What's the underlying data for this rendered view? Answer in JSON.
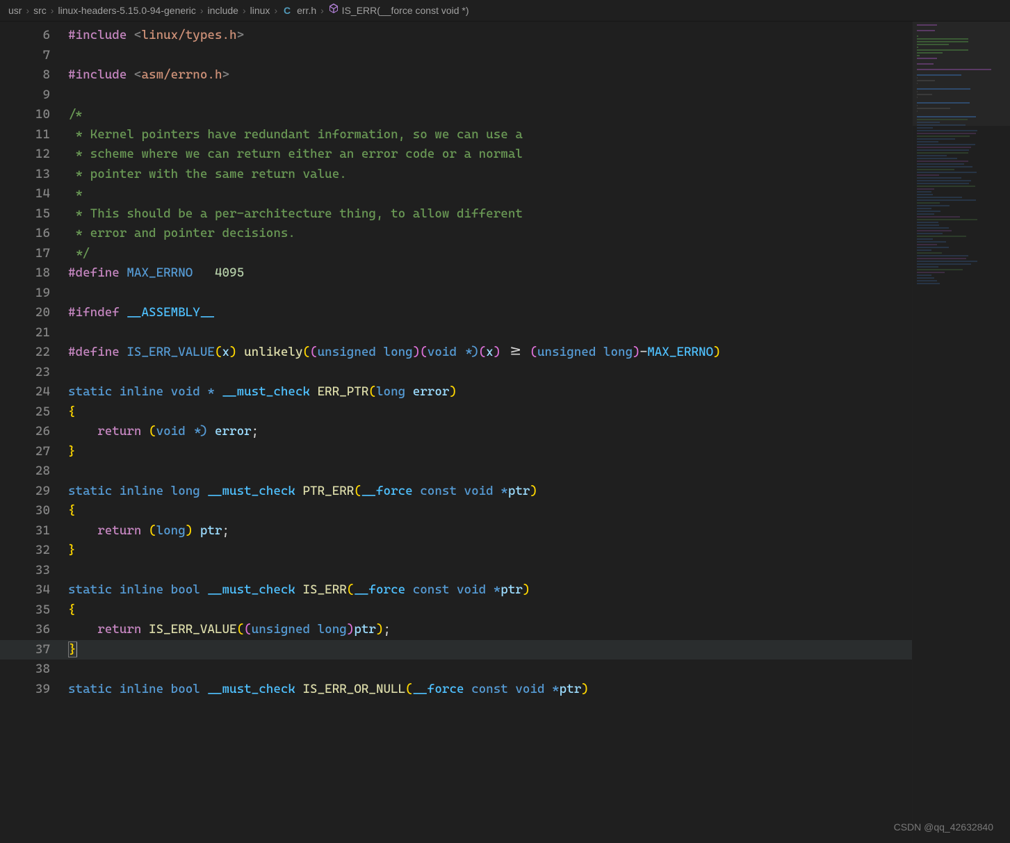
{
  "breadcrumbs": {
    "items": [
      {
        "label": "usr",
        "kind": "folder"
      },
      {
        "label": "src",
        "kind": "folder"
      },
      {
        "label": "linux-headers-5.15.0-94-generic",
        "kind": "folder"
      },
      {
        "label": "include",
        "kind": "folder"
      },
      {
        "label": "linux",
        "kind": "folder"
      },
      {
        "label": "err.h",
        "kind": "file",
        "lang": "C"
      },
      {
        "label": "IS_ERR(__force const void *)",
        "kind": "function"
      }
    ],
    "separator": "›"
  },
  "editor": {
    "first_line_number": 6,
    "current_line_number": 37,
    "lines": [
      {
        "n": 6,
        "tokens": [
          {
            "t": "#include ",
            "c": "tok-macro"
          },
          {
            "t": "<",
            "c": "tok-angle"
          },
          {
            "t": "linux/types.h",
            "c": "tok-inc-path"
          },
          {
            "t": ">",
            "c": "tok-angle"
          }
        ]
      },
      {
        "n": 7,
        "tokens": []
      },
      {
        "n": 8,
        "tokens": [
          {
            "t": "#include ",
            "c": "tok-macro"
          },
          {
            "t": "<",
            "c": "tok-angle"
          },
          {
            "t": "asm/errno.h",
            "c": "tok-inc-path"
          },
          {
            "t": ">",
            "c": "tok-angle"
          }
        ]
      },
      {
        "n": 9,
        "tokens": []
      },
      {
        "n": 10,
        "tokens": [
          {
            "t": "/*",
            "c": "tok-comment"
          }
        ]
      },
      {
        "n": 11,
        "tokens": [
          {
            "t": " * Kernel pointers have redundant information, so we can use a",
            "c": "tok-comment"
          }
        ]
      },
      {
        "n": 12,
        "tokens": [
          {
            "t": " * scheme where we can return either an error code or a normal",
            "c": "tok-comment"
          }
        ]
      },
      {
        "n": 13,
        "tokens": [
          {
            "t": " * pointer with the same return value.",
            "c": "tok-comment"
          }
        ]
      },
      {
        "n": 14,
        "tokens": [
          {
            "t": " *",
            "c": "tok-comment"
          }
        ]
      },
      {
        "n": 15,
        "tokens": [
          {
            "t": " * This should be a per-architecture thing, to allow different",
            "c": "tok-comment"
          }
        ]
      },
      {
        "n": 16,
        "tokens": [
          {
            "t": " * error and pointer decisions.",
            "c": "tok-comment"
          }
        ]
      },
      {
        "n": 17,
        "tokens": [
          {
            "t": " */",
            "c": "tok-comment"
          }
        ]
      },
      {
        "n": 18,
        "tokens": [
          {
            "t": "#define ",
            "c": "tok-macro"
          },
          {
            "t": "MAX_ERRNO",
            "c": "tok-define-name"
          },
          {
            "t": "   ",
            "c": ""
          },
          {
            "t": "4095",
            "c": "tok-number"
          }
        ]
      },
      {
        "n": 19,
        "tokens": []
      },
      {
        "n": 20,
        "tokens": [
          {
            "t": "#ifndef ",
            "c": "tok-macro"
          },
          {
            "t": "__ASSEMBLY__",
            "c": "tok-const"
          }
        ]
      },
      {
        "n": 21,
        "tokens": []
      },
      {
        "n": 22,
        "tokens": [
          {
            "t": "#define ",
            "c": "tok-macro"
          },
          {
            "t": "IS_ERR_VALUE",
            "c": "tok-define-name"
          },
          {
            "t": "(",
            "c": "p1"
          },
          {
            "t": "x",
            "c": "tok-ident"
          },
          {
            "t": ")",
            "c": "p1"
          },
          {
            "t": " ",
            "c": ""
          },
          {
            "t": "unlikely",
            "c": "tok-func"
          },
          {
            "t": "(",
            "c": "p1"
          },
          {
            "t": "(",
            "c": "p2"
          },
          {
            "t": "unsigned long",
            "c": "tok-kw"
          },
          {
            "t": ")",
            "c": "p2"
          },
          {
            "t": "(",
            "c": "p2"
          },
          {
            "t": "void ",
            "c": "tok-kw"
          },
          {
            "t": "*",
            "c": "tok-kw"
          },
          {
            "t": ")",
            "c": "p2"
          },
          {
            "t": "(",
            "c": "p2"
          },
          {
            "t": "x",
            "c": "tok-ident"
          },
          {
            "t": ")",
            "c": "p2"
          },
          {
            "t": " >= ",
            "c": "tok-op"
          },
          {
            "t": "(",
            "c": "p2"
          },
          {
            "t": "unsigned long",
            "c": "tok-kw"
          },
          {
            "t": ")",
            "c": "p2"
          },
          {
            "t": "-",
            "c": "tok-op"
          },
          {
            "t": "MAX_ERRNO",
            "c": "tok-const"
          },
          {
            "t": ")",
            "c": "p1"
          }
        ]
      },
      {
        "n": 23,
        "tokens": []
      },
      {
        "n": 24,
        "tokens": [
          {
            "t": "static inline void ",
            "c": "tok-kw"
          },
          {
            "t": "*",
            "c": "tok-kw"
          },
          {
            "t": " ",
            "c": ""
          },
          {
            "t": "__must_check",
            "c": "tok-const"
          },
          {
            "t": " ",
            "c": ""
          },
          {
            "t": "ERR_PTR",
            "c": "tok-func"
          },
          {
            "t": "(",
            "c": "p1"
          },
          {
            "t": "long ",
            "c": "tok-kw"
          },
          {
            "t": "error",
            "c": "tok-ident"
          },
          {
            "t": ")",
            "c": "p1"
          }
        ]
      },
      {
        "n": 25,
        "tokens": [
          {
            "t": "{",
            "c": "by1"
          }
        ]
      },
      {
        "n": 26,
        "indent": 1,
        "tokens": [
          {
            "t": "return ",
            "c": "tok-ret"
          },
          {
            "t": "(",
            "c": "p1"
          },
          {
            "t": "void ",
            "c": "tok-kw"
          },
          {
            "t": "*",
            "c": "tok-kw"
          },
          {
            "t": ")",
            "c": "p1"
          },
          {
            "t": " ",
            "c": ""
          },
          {
            "t": "error",
            "c": "tok-ident"
          },
          {
            "t": ";",
            "c": "tok-op"
          }
        ]
      },
      {
        "n": 27,
        "tokens": [
          {
            "t": "}",
            "c": "by1"
          }
        ]
      },
      {
        "n": 28,
        "tokens": []
      },
      {
        "n": 29,
        "tokens": [
          {
            "t": "static inline long ",
            "c": "tok-kw"
          },
          {
            "t": "__must_check",
            "c": "tok-const"
          },
          {
            "t": " ",
            "c": ""
          },
          {
            "t": "PTR_ERR",
            "c": "tok-func"
          },
          {
            "t": "(",
            "c": "p1"
          },
          {
            "t": "__force",
            "c": "tok-const"
          },
          {
            "t": " ",
            "c": ""
          },
          {
            "t": "const void ",
            "c": "tok-kw"
          },
          {
            "t": "*",
            "c": "tok-kw"
          },
          {
            "t": "ptr",
            "c": "tok-ident"
          },
          {
            "t": ")",
            "c": "p1"
          }
        ]
      },
      {
        "n": 30,
        "tokens": [
          {
            "t": "{",
            "c": "by1"
          }
        ]
      },
      {
        "n": 31,
        "indent": 1,
        "tokens": [
          {
            "t": "return ",
            "c": "tok-ret"
          },
          {
            "t": "(",
            "c": "p1"
          },
          {
            "t": "long",
            "c": "tok-kw"
          },
          {
            "t": ")",
            "c": "p1"
          },
          {
            "t": " ",
            "c": ""
          },
          {
            "t": "ptr",
            "c": "tok-ident"
          },
          {
            "t": ";",
            "c": "tok-op"
          }
        ]
      },
      {
        "n": 32,
        "tokens": [
          {
            "t": "}",
            "c": "by1"
          }
        ]
      },
      {
        "n": 33,
        "tokens": []
      },
      {
        "n": 34,
        "tokens": [
          {
            "t": "static inline bool ",
            "c": "tok-kw"
          },
          {
            "t": "__must_check",
            "c": "tok-const"
          },
          {
            "t": " ",
            "c": ""
          },
          {
            "t": "IS_ERR",
            "c": "tok-func"
          },
          {
            "t": "(",
            "c": "p1"
          },
          {
            "t": "__force",
            "c": "tok-const"
          },
          {
            "t": " ",
            "c": ""
          },
          {
            "t": "const void ",
            "c": "tok-kw"
          },
          {
            "t": "*",
            "c": "tok-kw"
          },
          {
            "t": "ptr",
            "c": "tok-ident"
          },
          {
            "t": ")",
            "c": "p1"
          }
        ]
      },
      {
        "n": 35,
        "tokens": [
          {
            "t": "{",
            "c": "by1",
            "bracket_match": true
          }
        ]
      },
      {
        "n": 36,
        "indent": 1,
        "tokens": [
          {
            "t": "return ",
            "c": "tok-ret"
          },
          {
            "t": "IS_ERR_VALUE",
            "c": "tok-func"
          },
          {
            "t": "(",
            "c": "p1"
          },
          {
            "t": "(",
            "c": "p2"
          },
          {
            "t": "unsigned long",
            "c": "tok-kw"
          },
          {
            "t": ")",
            "c": "p2"
          },
          {
            "t": "ptr",
            "c": "tok-ident"
          },
          {
            "t": ")",
            "c": "p1"
          },
          {
            "t": ";",
            "c": "tok-op"
          }
        ]
      },
      {
        "n": 37,
        "current": true,
        "tokens": [
          {
            "t": "}",
            "c": "by1",
            "bracket_match": true,
            "cursor_after": true
          }
        ]
      },
      {
        "n": 38,
        "tokens": []
      },
      {
        "n": 39,
        "tokens": [
          {
            "t": "static inline bool ",
            "c": "tok-kw"
          },
          {
            "t": "__must_check",
            "c": "tok-const"
          },
          {
            "t": " ",
            "c": ""
          },
          {
            "t": "IS_ERR_OR_NULL",
            "c": "tok-func"
          },
          {
            "t": "(",
            "c": "p1"
          },
          {
            "t": "__force",
            "c": "tok-const"
          },
          {
            "t": " ",
            "c": ""
          },
          {
            "t": "const void ",
            "c": "tok-kw"
          },
          {
            "t": "*",
            "c": "tok-kw"
          },
          {
            "t": "ptr",
            "c": "tok-ident"
          },
          {
            "t": ")",
            "c": "p1"
          }
        ]
      }
    ]
  },
  "watermark": "CSDN @qq_42632840"
}
